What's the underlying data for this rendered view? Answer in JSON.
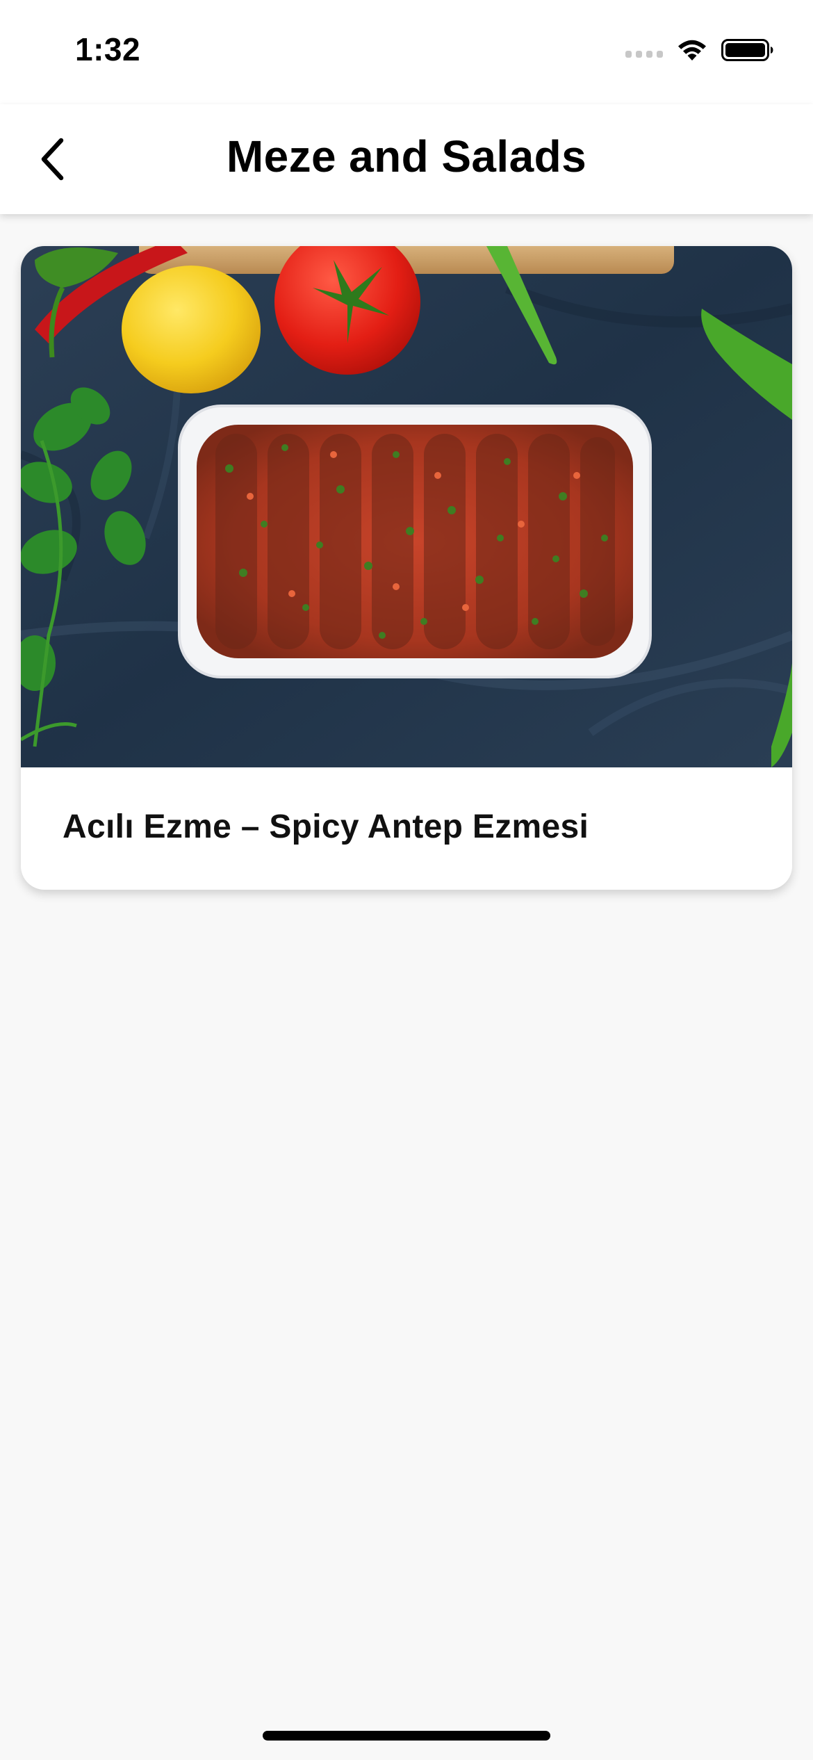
{
  "status_bar": {
    "time": "1:32"
  },
  "nav": {
    "title": "Meze and Salads",
    "back_icon": "chevron-left-icon"
  },
  "recipes": [
    {
      "title": "Acılı Ezme – Spicy Antep Ezmesi",
      "image_icon": "recipe-photo"
    }
  ],
  "colors": {
    "background": "#f8f8f8",
    "surface": "#ffffff",
    "text": "#000000"
  }
}
